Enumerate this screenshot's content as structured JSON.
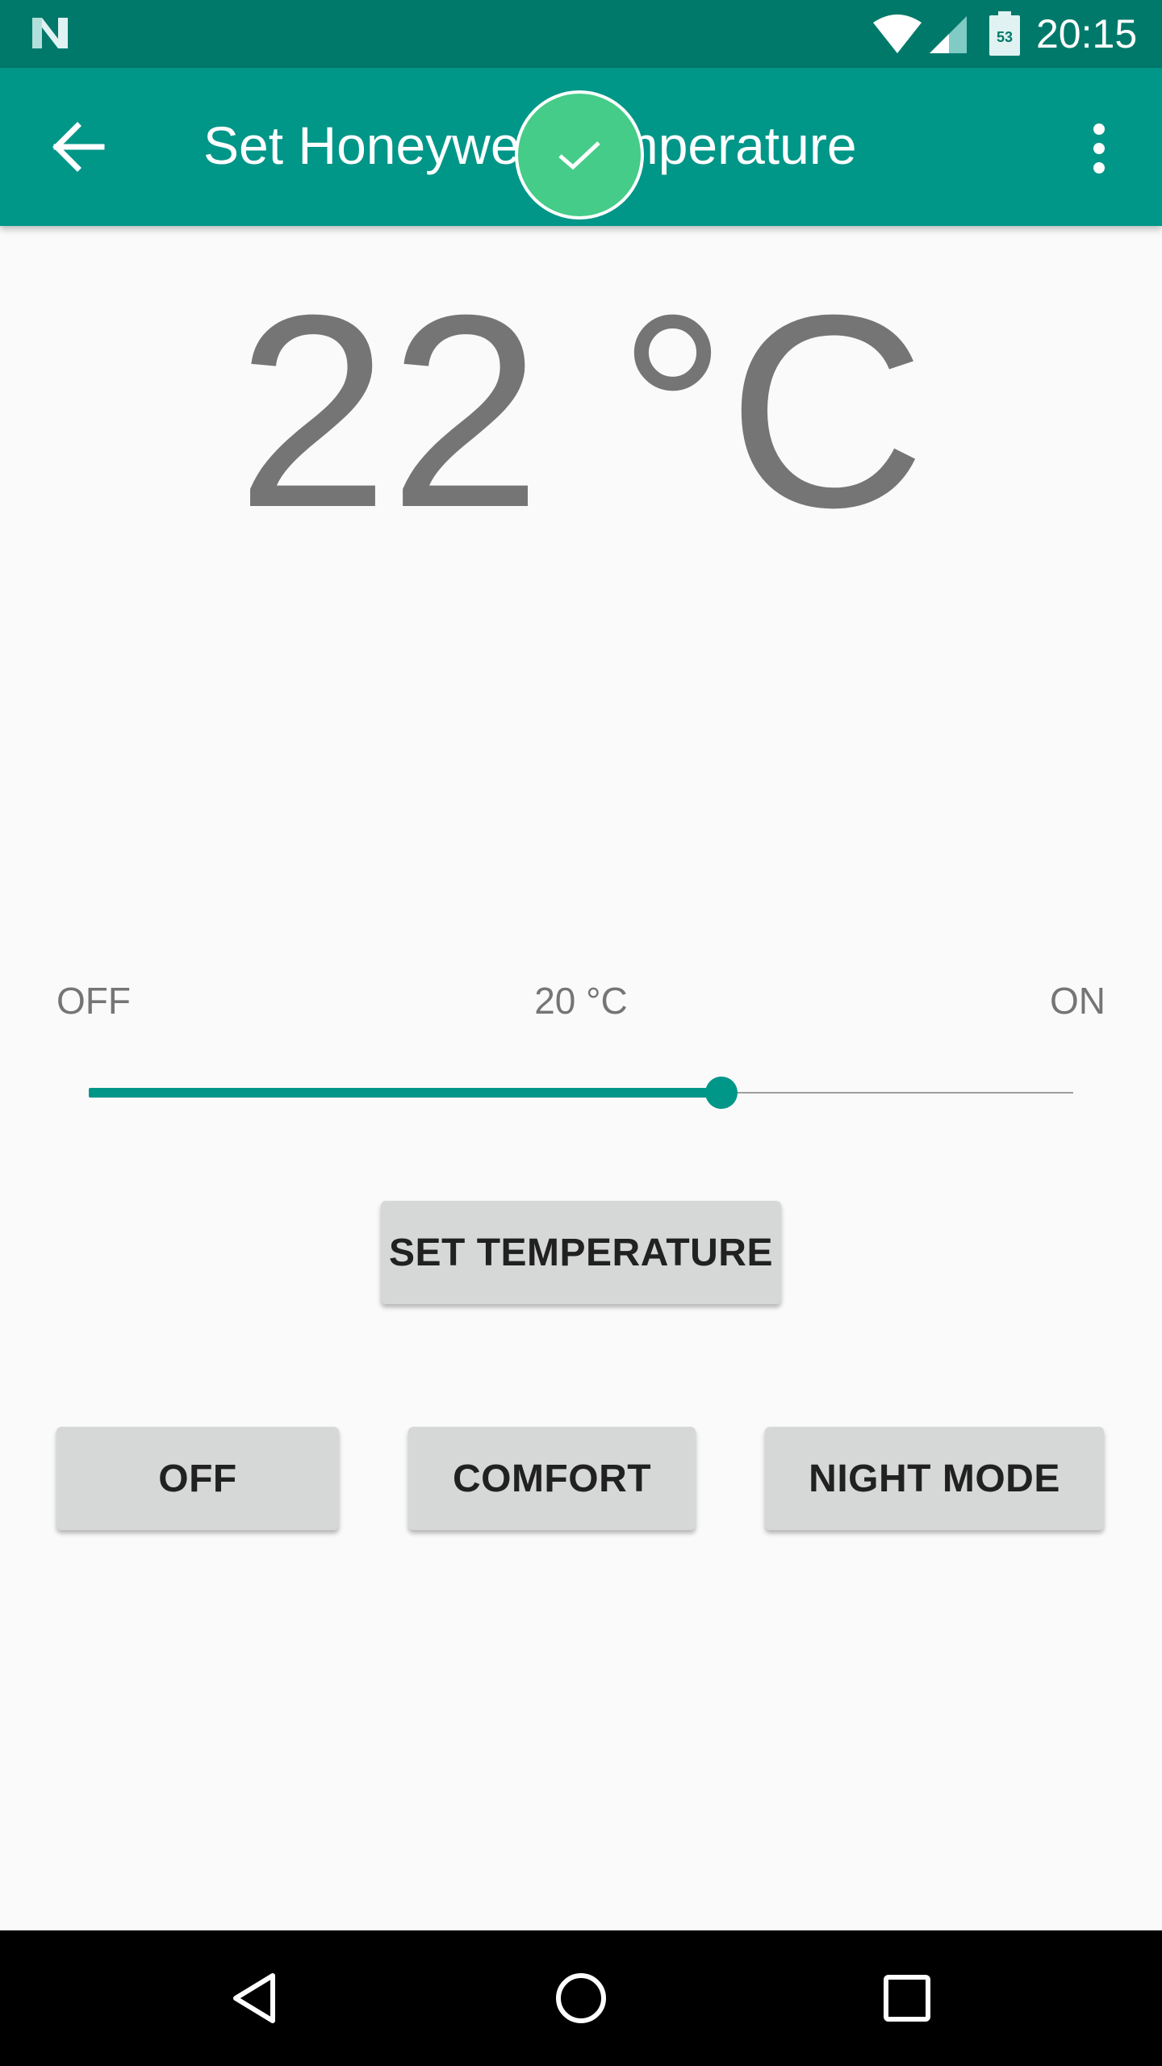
{
  "status_bar": {
    "time": "20:15",
    "battery_level": "53",
    "icons": [
      "n-logo-icon",
      "wifi-icon",
      "cell-signal-icon",
      "battery-icon"
    ]
  },
  "app_bar": {
    "title": "Set Honeywell Temperature",
    "back_icon": "arrow-back-icon",
    "overflow_icon": "more-vert-icon"
  },
  "toast": {
    "icon": "check-icon"
  },
  "thermostat": {
    "current_temperature": "22 °C",
    "slider": {
      "min_label": "OFF",
      "value_label": "20 °C",
      "max_label": "ON",
      "position": 0.643
    },
    "set_button": "SET TEMPERATURE",
    "modes": [
      "OFF",
      "COMFORT",
      "NIGHT MODE"
    ]
  },
  "colors": {
    "status_bar": "#00796b",
    "primary": "#009688",
    "success": "#44cc88",
    "button": "#d6d7d7"
  },
  "nav_bar": {
    "icons": [
      "back-triangle-icon",
      "home-circle-icon",
      "recents-square-icon"
    ]
  }
}
